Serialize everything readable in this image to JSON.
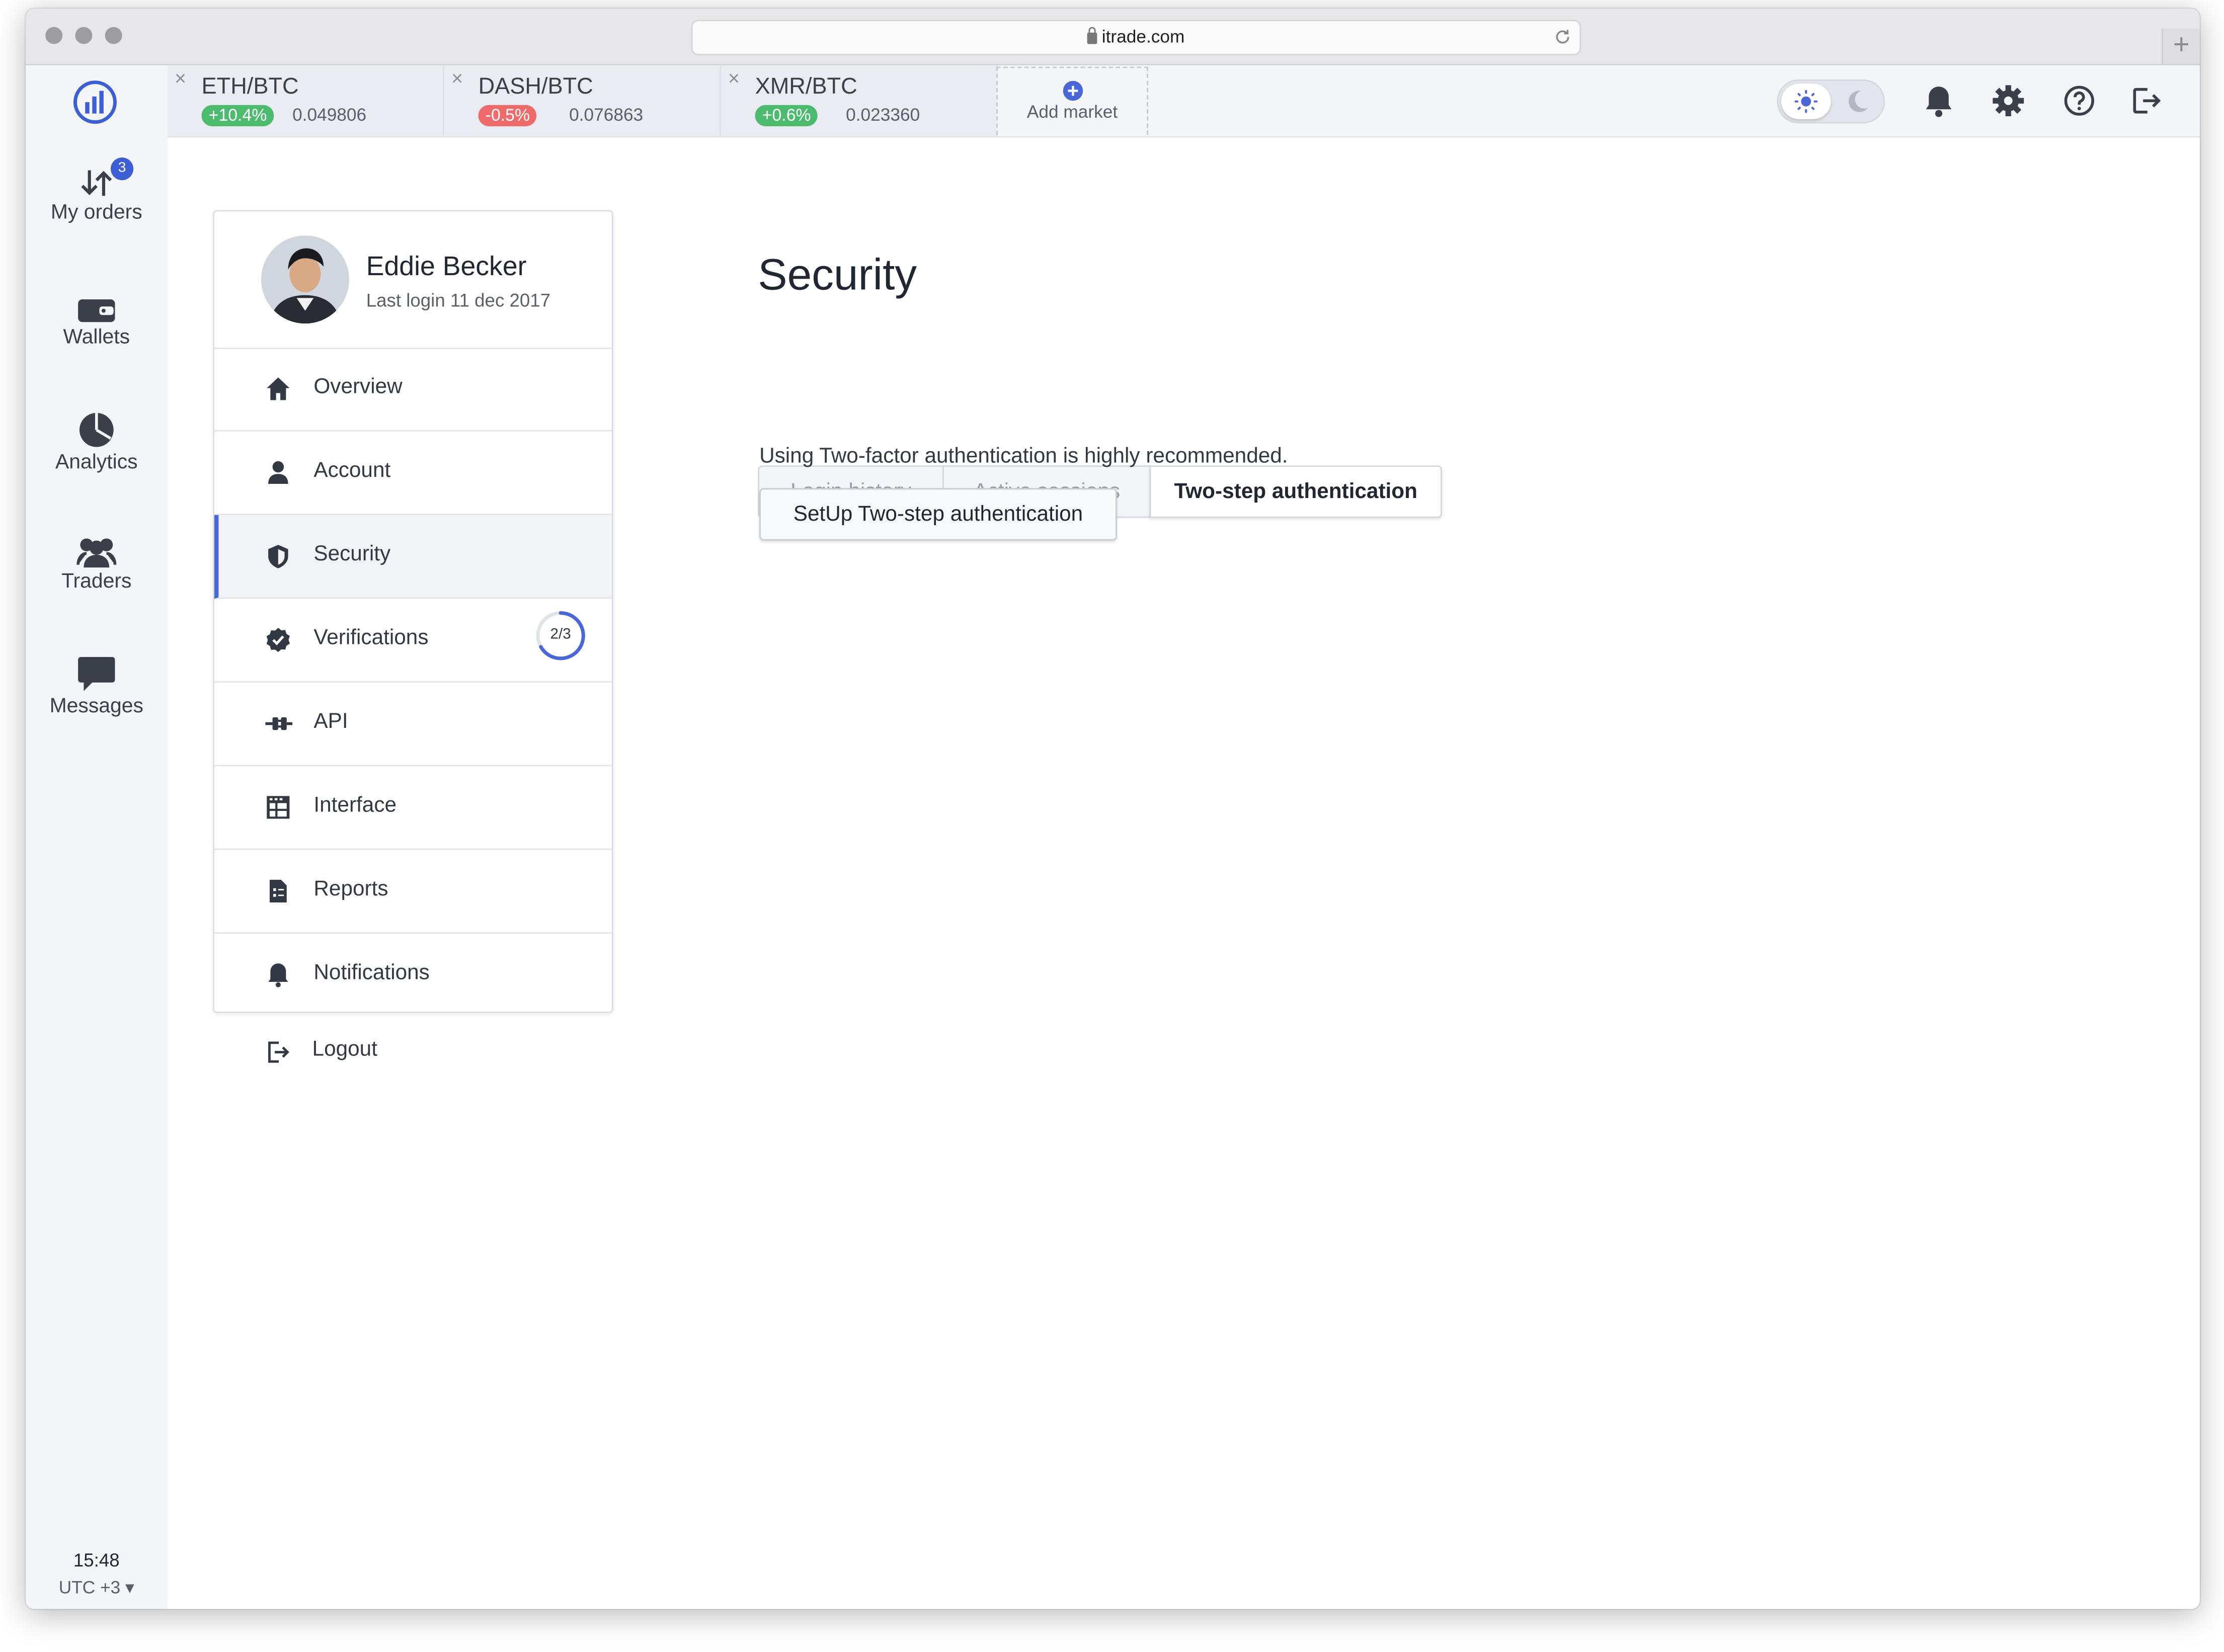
{
  "browser": {
    "url": "itrade.com",
    "new_tab": "+"
  },
  "sidebar": {
    "items": [
      {
        "label": "My orders",
        "badge": "3",
        "icon": "arrows-up-down-icon"
      },
      {
        "label": "Wallets",
        "icon": "wallet-icon"
      },
      {
        "label": "Analytics",
        "icon": "pie-chart-icon"
      },
      {
        "label": "Traders",
        "icon": "users-icon"
      },
      {
        "label": "Messages",
        "icon": "chat-icon"
      }
    ],
    "time": "15:48",
    "timezone": "UTC +3 ▾"
  },
  "markets": [
    {
      "pair": "ETH/BTC",
      "change": "+10.4%",
      "price": "0.049806",
      "color": "#4cbb6e"
    },
    {
      "pair": "DASH/BTC",
      "change": "-0.5%",
      "price": "0.076863",
      "color": "#ef6b6b"
    },
    {
      "pair": "XMR/BTC",
      "change": "+0.6%",
      "price": "0.023360",
      "color": "#4cbb6e"
    }
  ],
  "close_glyph": "×",
  "add_market": {
    "label": "Add market"
  },
  "profile": {
    "name": "Eddie Becker",
    "last_login": "Last login 11 dec 2017"
  },
  "menu": [
    {
      "label": "Overview",
      "icon": "home-icon"
    },
    {
      "label": "Account",
      "icon": "user-icon"
    },
    {
      "label": "Security",
      "icon": "shield-icon",
      "active": true
    },
    {
      "label": "Verifications",
      "icon": "check-badge-icon",
      "progress": "2/3",
      "progress_fraction": 0.667
    },
    {
      "label": "API",
      "icon": "plug-icon"
    },
    {
      "label": "Interface",
      "icon": "table-icon"
    },
    {
      "label": "Reports",
      "icon": "document-icon"
    },
    {
      "label": "Notifications",
      "icon": "bell-icon"
    }
  ],
  "logout": {
    "label": "Logout"
  },
  "page": {
    "title": "Security",
    "tabs": [
      "Login history",
      "Active sessions",
      "Two-step authentication"
    ],
    "active_tab": 2,
    "message": "Using Two-factor authentication is highly recommended.",
    "button": "SetUp Two-step authentication"
  },
  "colors": {
    "accent": "#4a66d8",
    "positive": "#4cbb6e",
    "negative": "#ef6b6b"
  }
}
